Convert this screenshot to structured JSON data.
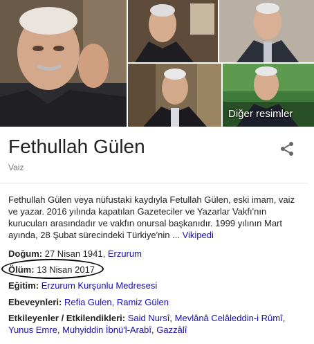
{
  "images": {
    "more_label": "Diğer resimler"
  },
  "header": {
    "title": "Fethullah Gülen",
    "subtitle": "Vaiz",
    "share_icon": "share-icon"
  },
  "description": {
    "text": "Fethullah Gülen veya nüfustaki kaydıyla Fetullah Gülen, eski imam, vaiz ve yazar. 2016 yılında kapatılan Gazeteciler ve Yazarlar Vakfı'nın kurucuları arasındadır ve vakfın onursal başkanıdır. 1999 yılının Mart ayında, 28 Şubat sürecindeki Türkiye'nin ... ",
    "source": "Vikipedi"
  },
  "facts": {
    "birth": {
      "label": "Doğum:",
      "date": "27 Nisan 1941,",
      "place": "Erzurum"
    },
    "death": {
      "label": "Ölüm:",
      "date": "13 Nisan 2017"
    },
    "education": {
      "label": "Eğitim:",
      "value": "Erzurum Kurşunlu Medresesi"
    },
    "parents": {
      "label": "Ebeveynleri:",
      "value1": "Refia Gulen",
      "sep": ", ",
      "value2": "Ramiz Gülen"
    },
    "influences": {
      "label": "Etkileyenler / Etkilendikleri:",
      "items": [
        "Said Nursî",
        "Mevlânâ Celâleddin-i Rûmî",
        "Yunus Emre",
        "Muhyiddin İbnü'l-Arabî",
        "Gazzâlî"
      ],
      "sep": ", "
    }
  },
  "colors": {
    "link": "#1a0dab",
    "text": "#222222",
    "muted": "#777777"
  }
}
